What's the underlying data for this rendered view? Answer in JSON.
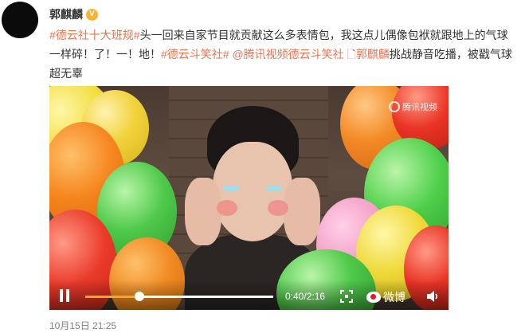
{
  "author": {
    "name": "郭麒麟",
    "verified_badge": "V"
  },
  "post": {
    "segments": [
      {
        "text": "#德云社十大班规#",
        "link": true
      },
      {
        "text": "头一回来自家节目就贡献这么多表情包，我这点儿偶像包袱就跟地上的气球一样碎！了！一！地！",
        "link": false
      },
      {
        "text": "#德云斗笑社#",
        "link": true
      },
      {
        "text": " ",
        "link": false
      },
      {
        "text": "@腾讯视频德云斗笑社",
        "link": true
      },
      {
        "text": " ",
        "link": false
      },
      {
        "text": "🗋郭麒麟",
        "link": true
      },
      {
        "text": "挑战静音吃播，被戳气球超无辜",
        "link": false
      }
    ]
  },
  "video": {
    "watermark": "腾讯视频",
    "elapsed_fraction": 0.29,
    "time_display": "0:40/2:16",
    "brand_label": "微博"
  },
  "timestamp": "10月15日 21:25",
  "colors": {
    "link": "#eb7350",
    "progress": "#f6a623",
    "text": "#333333"
  }
}
